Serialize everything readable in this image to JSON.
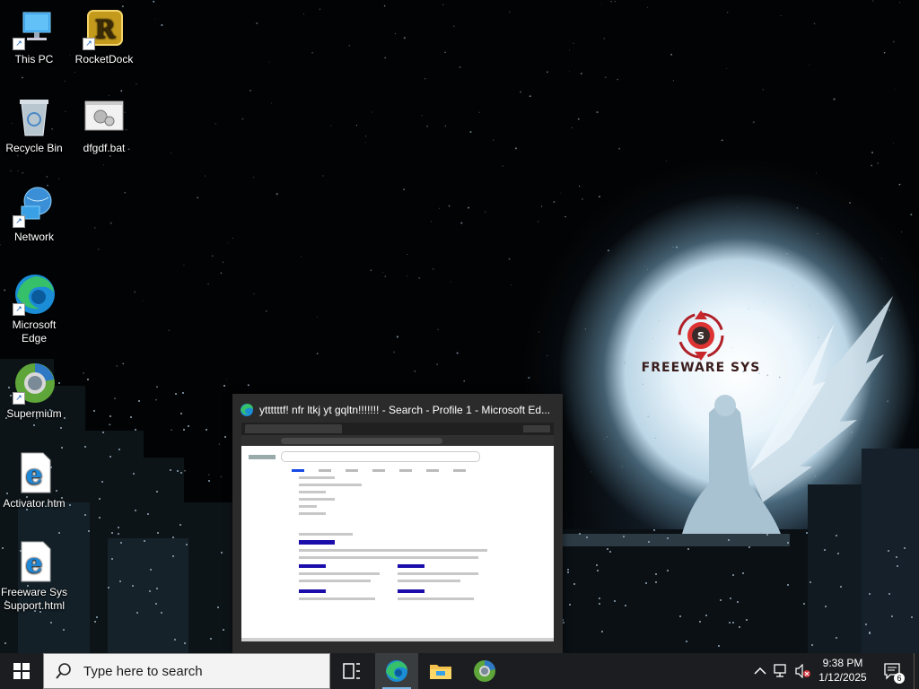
{
  "desktop": {
    "icons": [
      {
        "label": "This PC",
        "icon": "this-pc-icon"
      },
      {
        "label": "RocketDock",
        "icon": "rocketdock-icon"
      },
      {
        "label": "Recycle Bin",
        "icon": "recycle-bin-icon"
      },
      {
        "label": "dfgdf.bat",
        "icon": "batch-file-icon"
      },
      {
        "label": "Network",
        "icon": "network-icon"
      },
      {
        "label": "Microsoft Edge",
        "icon": "edge-icon"
      },
      {
        "label": "Supermium",
        "icon": "supermium-icon"
      },
      {
        "label": "Activator.htm",
        "icon": "html-file-icon"
      },
      {
        "label": "Freeware Sys Support.html",
        "icon": "html-file-icon"
      }
    ],
    "wallpaper_brand": "FREEWARE SYS"
  },
  "preview": {
    "title": "yttttttf! nfr ltkj yt gqltn!!!!!!! - Search - Profile 1 - Microsoft Ed..."
  },
  "taskbar": {
    "search_placeholder": "Type here to search",
    "time": "9:38 PM",
    "date": "1/12/2025",
    "notification_count": "6"
  },
  "colors": {
    "taskbar_bg": "#1b1d20",
    "accent": "#7ab4e6"
  }
}
